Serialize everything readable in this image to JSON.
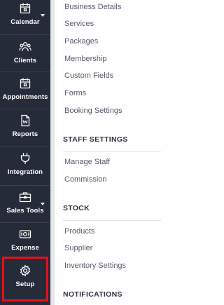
{
  "sidebar": {
    "items": [
      {
        "label": "Calendar",
        "icon": "calendar-icon"
      },
      {
        "label": "Clients",
        "icon": "clients-icon"
      },
      {
        "label": "Appointments",
        "icon": "appointments-icon"
      },
      {
        "label": "Reports",
        "icon": "reports-icon"
      },
      {
        "label": "Integration",
        "icon": "plug-icon"
      },
      {
        "label": "Sales Tools",
        "icon": "briefcase-icon"
      },
      {
        "label": "Expense",
        "icon": "money-icon"
      },
      {
        "label": "Setup",
        "icon": "gear-icon"
      }
    ],
    "highlight_color": "#e8101c"
  },
  "setup_menu": {
    "general_links": [
      "Business Details",
      "Services",
      "Packages",
      "Membership",
      "Custom Fields",
      "Forms",
      "Booking Settings"
    ],
    "staff_section": {
      "title": "STAFF SETTINGS",
      "links": [
        "Manage Staff",
        "Commission"
      ]
    },
    "stock_section": {
      "title": "STOCK",
      "links": [
        "Products",
        "Supplier",
        "Inventory Settings"
      ]
    },
    "notifications_section": {
      "title": "NOTIFICATIONS"
    }
  },
  "colors": {
    "sidebar_bg": "#262b3a",
    "link_text": "#555b6a",
    "section_title": "#2e3342"
  }
}
